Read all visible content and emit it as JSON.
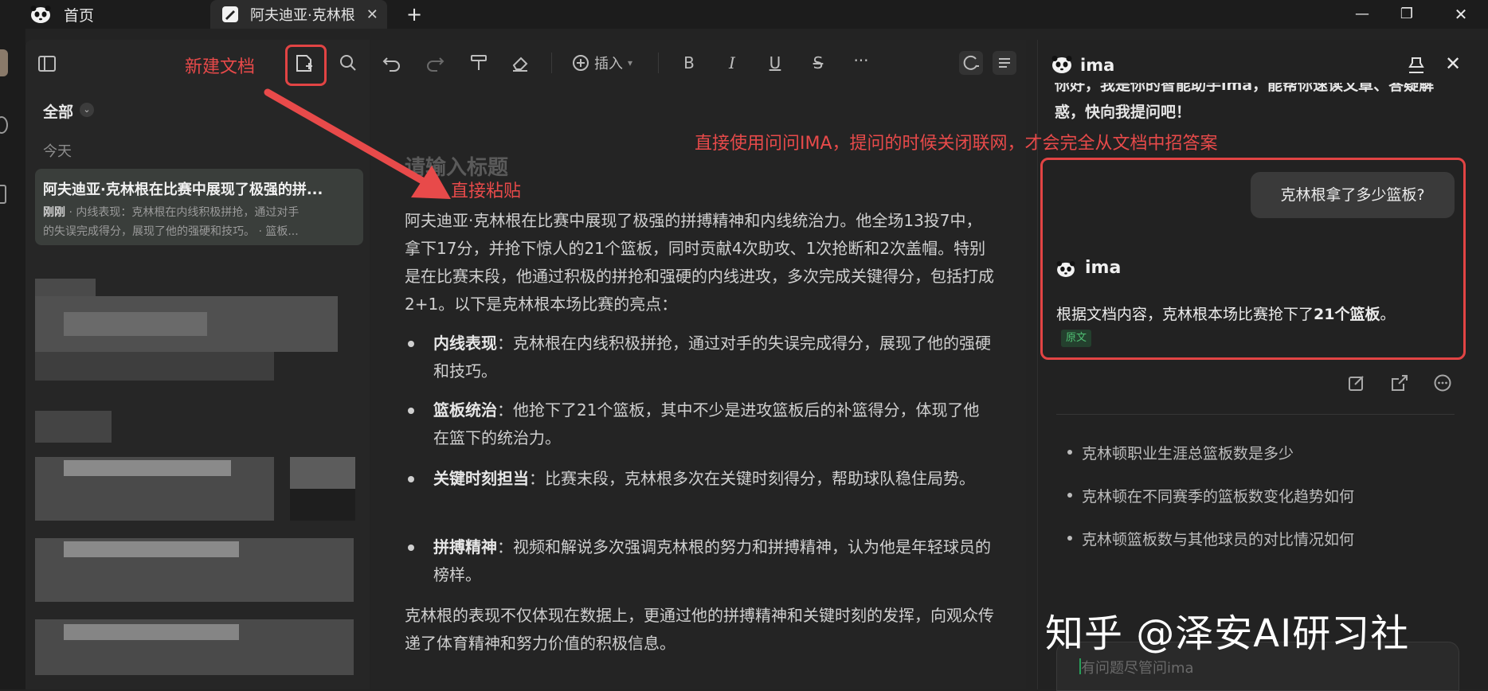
{
  "titlebar": {
    "home_tab": "首页",
    "doc_tab": "阿夫迪亚·克林根",
    "new_tab": "+",
    "minimize": "—",
    "maximize": "❐",
    "close": "✕"
  },
  "toolbar": {
    "insert_label": "插入",
    "bold": "B",
    "italic": "I",
    "underline": "U",
    "strike": "S",
    "more": "···"
  },
  "sidebar": {
    "filter_label": "全部",
    "section_today": "今天",
    "doc_item": {
      "title": "阿夫迪亚·克林根在比赛中展现了极强的拼...",
      "time": "刚刚",
      "preview_line1": " · 内线表现：克林根在内线积极拼抢，通过对手",
      "preview_line2": "的失误完成得分，展现了他的强硬和技巧。 · 篮板..."
    }
  },
  "annotations": {
    "new_doc": "新建文档",
    "paste": "直接粘贴",
    "chat_tip": "直接使用问问IMA，提问的时候关闭联网，才会完全从文档中招答案",
    "watermark": "知乎 @泽安AI研习社"
  },
  "editor": {
    "title_placeholder": "请输入标题",
    "intro": "阿夫迪亚·克林根在比赛中展现了极强的拼搏精神和内线统治力。他全场13投7中，拿下17分，并抢下惊人的21个篮板，同时贡献4次助攻、1次抢断和2次盖帽。特别是在比赛末段，他通过积极的拼抢和强硬的内线进攻，多次完成关键得分，包括打成2+1。以下是克林根本场比赛的亮点：",
    "bullets": [
      {
        "title": "内线表现",
        "text": "：克林根在内线积极拼抢，通过对手的失误完成得分，展现了他的强硬和技巧。"
      },
      {
        "title": "篮板统治",
        "text": "：他抢下了21个篮板，其中不少是进攻篮板后的补篮得分，体现了他在篮下的统治力。"
      },
      {
        "title": "关键时刻担当",
        "text": "：比赛末段，克林根多次在关键时刻得分，帮助球队稳住局势。"
      },
      {
        "title": "拼搏精神",
        "text": "：视频和解说多次强调克林根的努力和拼搏精神，认为他是年轻球员的榜样。"
      }
    ],
    "outro": "克林根的表现不仅体现在数据上，更通过他的拼搏精神和关键时刻的发挥，向观众传递了体育精神和努力价值的积极信息。"
  },
  "chat": {
    "app_name": "ima",
    "greeting": "你好，我是你的智能助手ima，能帮你速读文章、答疑解惑，快向我提问吧！",
    "user_question": "克林根拿了多少篮板?",
    "bot_name": "ima",
    "answer_prefix": "根据文档内容，克林根本场比赛抢下了",
    "answer_bold": "21个篮板",
    "answer_suffix": "。",
    "source_tag": "原文",
    "suggestions": [
      "克林顿职业生涯总篮板数是多少",
      "克林顿在不同赛季的篮板数变化趋势如何",
      "克林顿篮板数与其他球员的对比情况如何"
    ],
    "input_placeholder": "有问题尽管问ima"
  }
}
